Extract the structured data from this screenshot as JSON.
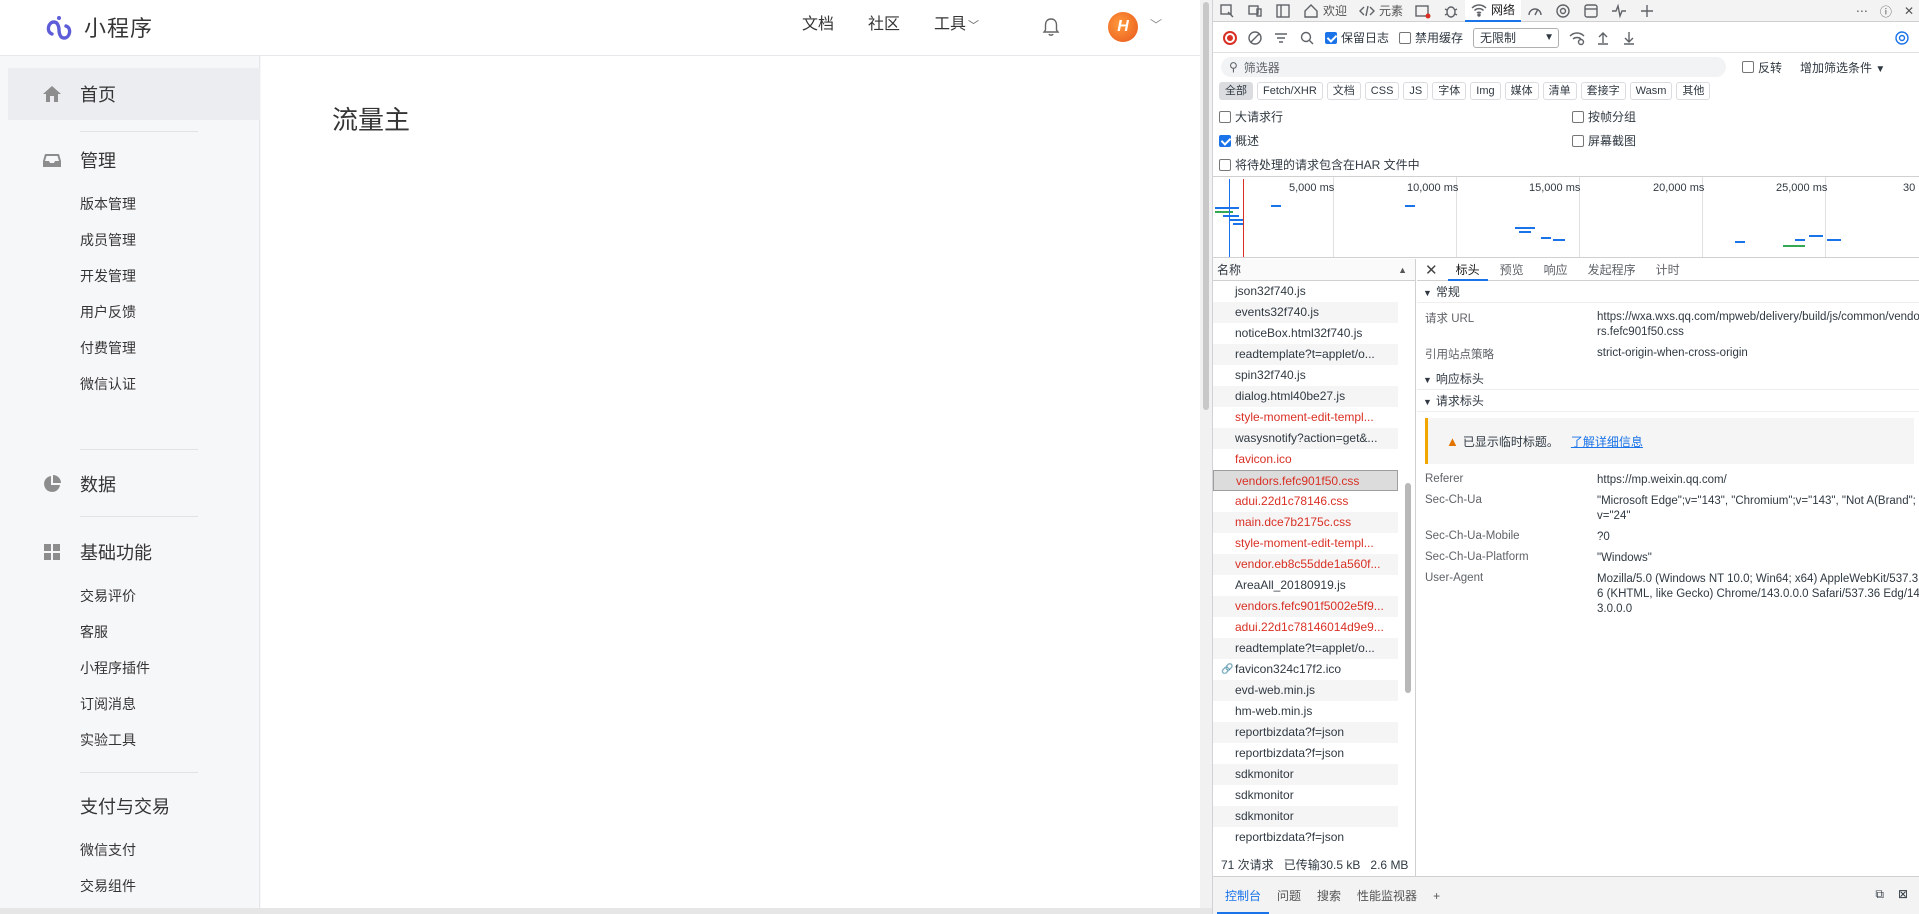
{
  "app": {
    "logo_text": "小程序",
    "nav": {
      "docs": "文档",
      "community": "社区",
      "tools": "工具"
    },
    "page_title": "流量主",
    "sidebar": {
      "home": "首页",
      "manage": {
        "title": "管理",
        "items": [
          "版本管理",
          "成员管理",
          "开发管理",
          "用户反馈",
          "付费管理",
          "微信认证"
        ]
      },
      "data": "数据",
      "basic": {
        "title": "基础功能",
        "items": [
          "交易评价",
          "客服",
          "小程序插件",
          "订阅消息",
          "实验工具"
        ]
      },
      "pay": {
        "title": "支付与交易",
        "items": [
          "微信支付",
          "交易组件"
        ]
      }
    }
  },
  "devtools": {
    "tabs": {
      "welcome": "欢迎",
      "elements": "元素",
      "network": "网络"
    },
    "toolbar": {
      "preserve_log": "保留日志",
      "disable_cache": "禁用缓存",
      "throttle": "无限制"
    },
    "filter": {
      "placeholder": "筛选器",
      "invert": "反转",
      "more": "增加筛选条件"
    },
    "types": [
      "全部",
      "Fetch/XHR",
      "文档",
      "CSS",
      "JS",
      "字体",
      "Img",
      "媒体",
      "清单",
      "套接字",
      "Wasm",
      "其他"
    ],
    "options": {
      "big_rows": "大请求行",
      "group_by_frame": "按帧分组",
      "overview": "概述",
      "screenshots": "屏幕截图",
      "har": "将待处理的请求包含在HAR 文件中"
    },
    "timeline_labels": [
      "5,000 ms",
      "10,000 ms",
      "15,000 ms",
      "20,000 ms",
      "25,000 ms",
      "30"
    ],
    "list_header": "名称",
    "requests": [
      {
        "name": "json32f740.js",
        "err": false
      },
      {
        "name": "events32f740.js",
        "err": false
      },
      {
        "name": "noticeBox.html32f740.js",
        "err": false
      },
      {
        "name": "readtemplate?t=applet/o...",
        "err": false
      },
      {
        "name": "spin32f740.js",
        "err": false
      },
      {
        "name": "dialog.html40be27.js",
        "err": false
      },
      {
        "name": "style-moment-edit-templ...",
        "err": true
      },
      {
        "name": "wasysnotify?action=get&...",
        "err": false
      },
      {
        "name": "favicon.ico",
        "err": true
      },
      {
        "name": "vendors.fefc901f50.css",
        "err": true,
        "selected": true
      },
      {
        "name": "adui.22d1c78146.css",
        "err": true
      },
      {
        "name": "main.dce7b2175c.css",
        "err": true
      },
      {
        "name": "style-moment-edit-templ...",
        "err": true
      },
      {
        "name": "vendor.eb8c55dde1a560f...",
        "err": true
      },
      {
        "name": "AreaAll_20180919.js",
        "err": false
      },
      {
        "name": "vendors.fefc901f5002e5f9...",
        "err": true
      },
      {
        "name": "adui.22d1c78146014d9e9...",
        "err": true
      },
      {
        "name": "readtemplate?t=applet/o...",
        "err": false
      },
      {
        "name": "favicon324c17f2.ico",
        "err": false,
        "link": true
      },
      {
        "name": "evd-web.min.js",
        "err": false
      },
      {
        "name": "hm-web.min.js",
        "err": false
      },
      {
        "name": "reportbizdata?f=json",
        "err": false
      },
      {
        "name": "reportbizdata?f=json",
        "err": false
      },
      {
        "name": "sdkmonitor",
        "err": false
      },
      {
        "name": "sdkmonitor",
        "err": false
      },
      {
        "name": "sdkmonitor",
        "err": false
      },
      {
        "name": "reportbizdata?f=json",
        "err": false
      }
    ],
    "status": {
      "requests": "71 次请求",
      "transferred": "已传输30.5 kB",
      "size": "2.6 MB"
    },
    "detail_tabs": [
      "标头",
      "预览",
      "响应",
      "发起程序",
      "计时"
    ],
    "general": {
      "title": "常规",
      "request_url_label": "请求 URL",
      "request_url": "https://wxa.wxs.qq.com/mpweb/delivery/build/js/common/vendors.fefc901f50.css",
      "referrer_policy_label": "引用站点策略",
      "referrer_policy": "strict-origin-when-cross-origin"
    },
    "response_headers_title": "响应标头",
    "request_headers_title": "请求标头",
    "warning": {
      "text": "已显示临时标题。",
      "link": "了解详细信息"
    },
    "headers": [
      {
        "k": "Referer",
        "v": "https://mp.weixin.qq.com/"
      },
      {
        "k": "Sec-Ch-Ua",
        "v": "\"Microsoft Edge\";v=\"143\", \"Chromium\";v=\"143\", \"Not A(Brand\";v=\"24\""
      },
      {
        "k": "Sec-Ch-Ua-Mobile",
        "v": "?0"
      },
      {
        "k": "Sec-Ch-Ua-Platform",
        "v": "\"Windows\""
      },
      {
        "k": "User-Agent",
        "v": "Mozilla/5.0 (Windows NT 10.0; Win64; x64) AppleWebKit/537.36 (KHTML, like Gecko) Chrome/143.0.0.0 Safari/537.36 Edg/143.0.0.0"
      }
    ],
    "drawer": [
      "控制台",
      "问题",
      "搜索",
      "性能监视器"
    ]
  }
}
